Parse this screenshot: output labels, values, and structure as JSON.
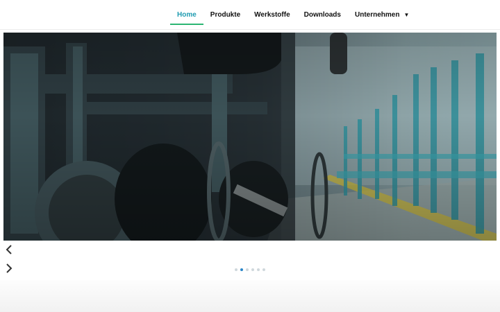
{
  "nav": {
    "items": [
      {
        "label": "Home",
        "active": true
      },
      {
        "label": "Produkte",
        "active": false
      },
      {
        "label": "Werkstoffe",
        "active": false
      },
      {
        "label": "Downloads",
        "active": false
      },
      {
        "label": "Unternehmen",
        "active": false,
        "dropdown": true
      }
    ],
    "active_color": "#1f9bb0",
    "underline_color": "#2bb673"
  },
  "slider": {
    "dot_count": 6,
    "active_dot": 1,
    "active_dot_color": "#2a86c8",
    "prev_icon": "chevron-left-icon",
    "next_icon": "chevron-right-icon"
  }
}
